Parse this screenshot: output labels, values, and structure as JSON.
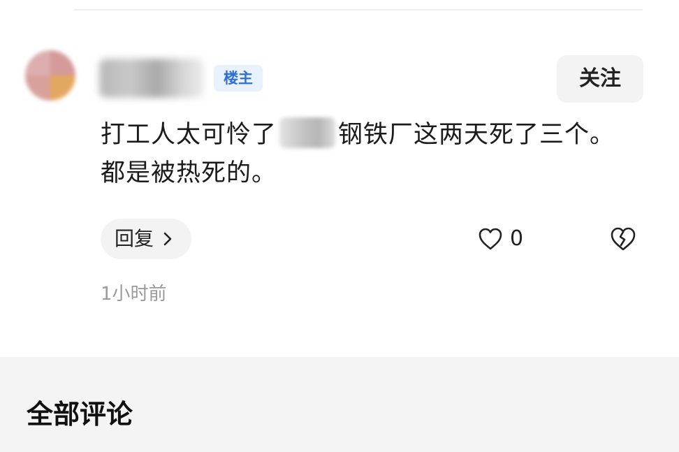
{
  "comment": {
    "op_badge": "楼主",
    "follow_label": "关注",
    "text_before_redaction": "打工人太可怜了",
    "text_after_redaction": "钢铁厂这两天死了三个。都是被热死的。",
    "reply_label": "回复",
    "like_count": "0",
    "timestamp": "1小时前"
  },
  "section": {
    "title": "全部评论"
  },
  "icons": {
    "like": "heart-icon",
    "dislike": "broken-heart-icon",
    "reply_arrow": "chevron-right-icon"
  },
  "colors": {
    "op_badge_bg": "#e8f1fc",
    "op_badge_text": "#2f6fd6",
    "button_bg": "#f3f3f3",
    "muted_text": "#9a9a9a"
  }
}
